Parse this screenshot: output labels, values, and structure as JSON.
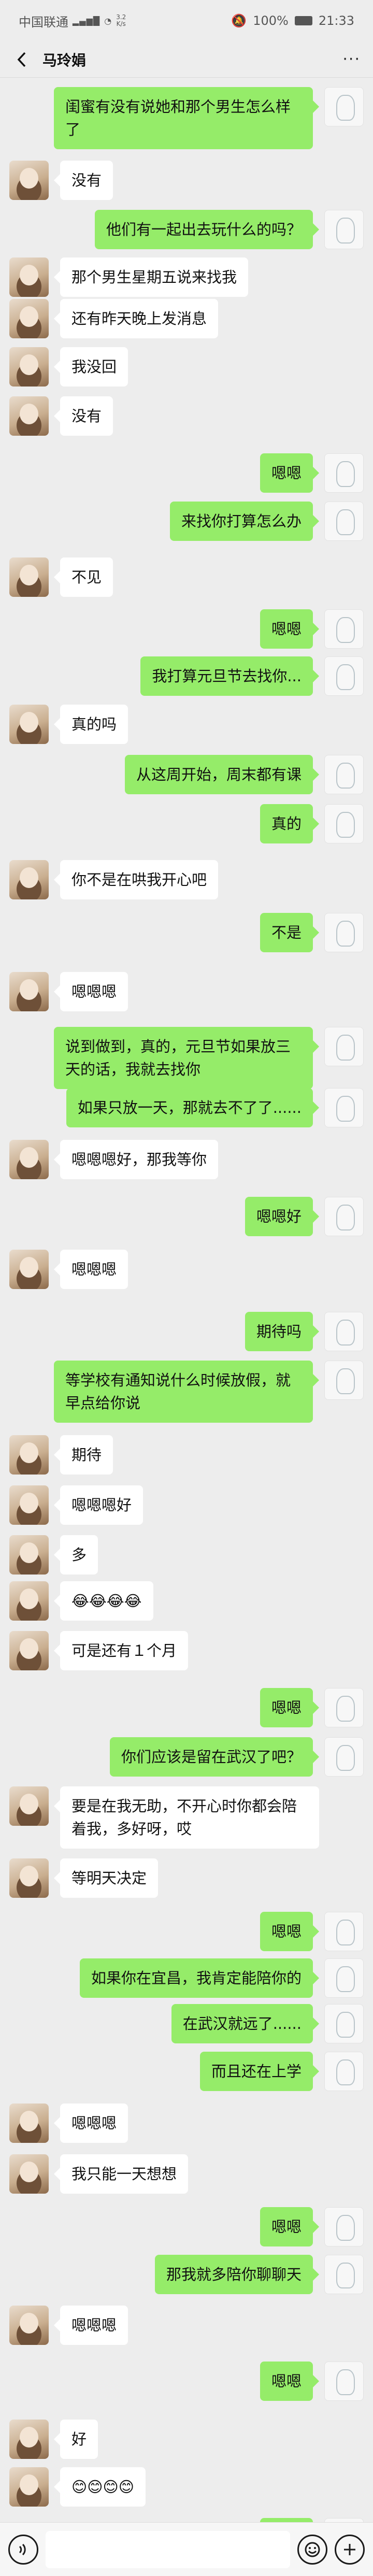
{
  "status_bar": {
    "carrier": "中国联通",
    "network_speed": "3.2\nK/s",
    "battery": "100%",
    "time": "21:33"
  },
  "chat": {
    "contact_name": "马玲娟",
    "more_label": "···",
    "messages": [
      {
        "side": "out",
        "text": "闺蜜有没有说她和那个男生怎么样了"
      },
      {
        "side": "in",
        "text": "没有"
      },
      {
        "side": "out",
        "text": "他们有一起出去玩什么的吗？"
      },
      {
        "side": "in",
        "text": "那个男生星期五说来找我"
      },
      {
        "side": "in",
        "text": "还有昨天晚上发消息"
      },
      {
        "side": "in",
        "text": "我没回"
      },
      {
        "side": "in",
        "text": "没有"
      },
      {
        "side": "out",
        "text": "嗯嗯"
      },
      {
        "side": "out",
        "text": "来找你打算怎么办"
      },
      {
        "side": "in",
        "text": "不见"
      },
      {
        "side": "out",
        "text": "嗯嗯"
      },
      {
        "side": "out",
        "text": "我打算元旦节去找你..."
      },
      {
        "side": "in",
        "text": "真的吗"
      },
      {
        "side": "out",
        "text": "从这周开始，周末都有课"
      },
      {
        "side": "out",
        "text": "真的"
      },
      {
        "side": "in",
        "text": "你不是在哄我开心吧"
      },
      {
        "side": "out",
        "text": "不是"
      },
      {
        "side": "in",
        "text": "嗯嗯嗯"
      },
      {
        "side": "out",
        "text": "说到做到，真的，元旦节如果放三天的话，我就去找你"
      },
      {
        "side": "out",
        "text": "如果只放一天，那就去不了了......"
      },
      {
        "side": "in",
        "text": "嗯嗯嗯好，那我等你"
      },
      {
        "side": "out",
        "text": "嗯嗯好"
      },
      {
        "side": "in",
        "text": "嗯嗯嗯"
      },
      {
        "side": "out",
        "text": "期待吗"
      },
      {
        "side": "out",
        "text": "等学校有通知说什么时候放假，就早点给你说"
      },
      {
        "side": "in",
        "text": "期待"
      },
      {
        "side": "in",
        "text": "嗯嗯嗯好"
      },
      {
        "side": "in",
        "text": "多"
      },
      {
        "side": "in",
        "text": "😂😂😂😂"
      },
      {
        "side": "in",
        "text": "可是还有１个月"
      },
      {
        "side": "out",
        "text": "嗯嗯"
      },
      {
        "side": "out",
        "text": "你们应该是留在武汉了吧？"
      },
      {
        "side": "in",
        "text": "要是在我无助，不开心时你都会陪着我，多好呀，哎"
      },
      {
        "side": "in",
        "text": "等明天决定"
      },
      {
        "side": "out",
        "text": "嗯嗯"
      },
      {
        "side": "out",
        "text": "如果你在宜昌，我肯定能陪你的"
      },
      {
        "side": "out",
        "text": "在武汉就远了......"
      },
      {
        "side": "out",
        "text": "而且还在上学"
      },
      {
        "side": "in",
        "text": "嗯嗯嗯"
      },
      {
        "side": "in",
        "text": "我只能一天想想"
      },
      {
        "side": "out",
        "text": "嗯嗯"
      },
      {
        "side": "out",
        "text": "那我就多陪你聊聊天"
      },
      {
        "side": "in",
        "text": "嗯嗯嗯"
      },
      {
        "side": "out",
        "text": "嗯嗯"
      },
      {
        "side": "in",
        "text": "好"
      },
      {
        "side": "in",
        "text": "😊😊😊😊"
      },
      {
        "side": "out",
        "text": "嗯嗯"
      },
      {
        "side": "in",
        "text": "😠😠😠"
      }
    ]
  },
  "input_bar": {
    "placeholder": ""
  }
}
